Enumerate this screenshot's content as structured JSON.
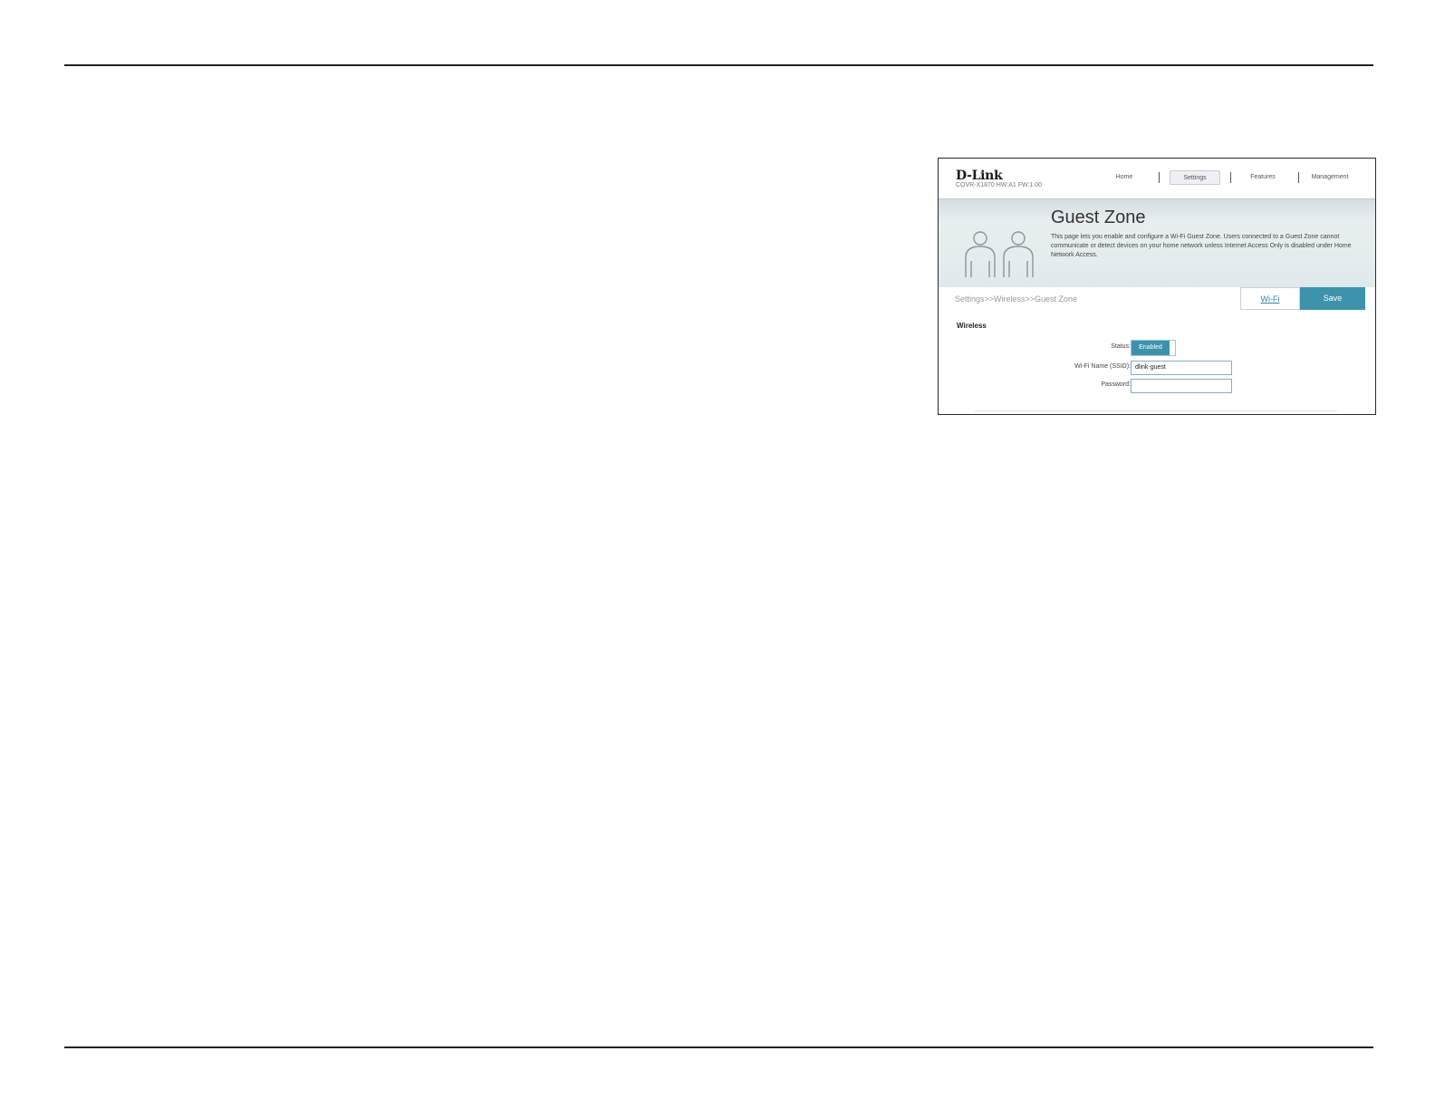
{
  "header": {
    "logo": "D-Link",
    "model": "COVR-X1870 HW:A1 FW:1.00",
    "nav": {
      "home": "Home",
      "settings": "Settings",
      "features": "Features",
      "management": "Management"
    }
  },
  "banner": {
    "title": "Guest Zone",
    "description": "This page lets you enable and configure a Wi-Fi Guest Zone. Users connected to a Guest Zone cannot communicate or detect devices on your home network unless Internet Access Only is disabled under Home Network Access."
  },
  "toolbar": {
    "breadcrumb": "Settings>>Wireless>>Guest Zone",
    "wifi_link": "Wi-Fi",
    "save_label": "Save"
  },
  "wireless": {
    "section_title": "Wireless",
    "status_label": "Status:",
    "status_value": "Enabled",
    "ssid_label": "Wi-Fi Name (SSID):",
    "ssid_value": "dlink-guest",
    "password_label": "Password:",
    "password_value": ""
  },
  "colors": {
    "accent": "#3e93ac",
    "link": "#3b7fa8"
  }
}
